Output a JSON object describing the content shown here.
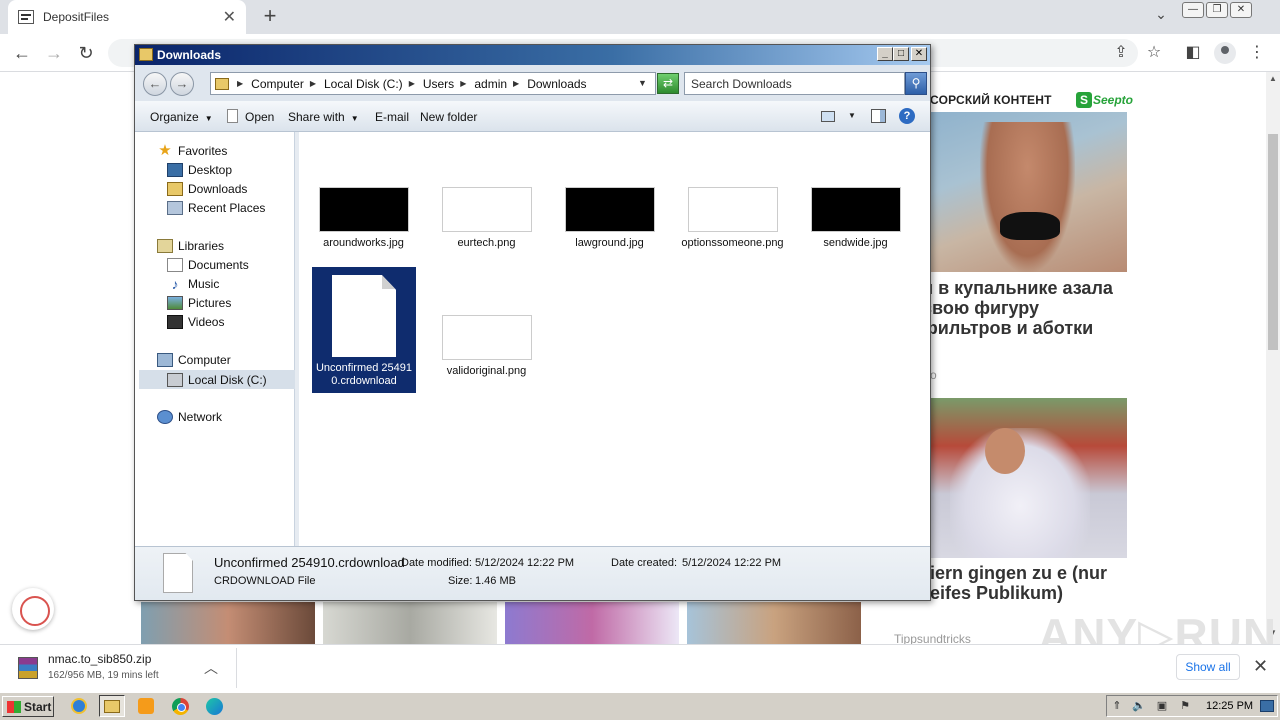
{
  "browser": {
    "tab_title": "DepositFiles",
    "tab_close": "✕",
    "new_tab": "+",
    "nav": {
      "back": "←",
      "forward": "→",
      "reload": "↻"
    }
  },
  "page_content": {
    "ad_header": "СОРСКИЙ КОНТЕНТ",
    "ad_logo": "Seepto",
    "ad_logo_letter": "S",
    "ad1_text": "и в купальнике азала свою фигуру фильтров и аботки",
    "ad1_source": "о",
    "ad2_text": "e Feiern gingen zu e (nur für reifes Publikum)",
    "ad2_source": "Tippsundtricks",
    "watermark": "ANY▷RUN"
  },
  "download_shelf": {
    "filename": "nmac.to_sib850.zip",
    "status": "162/956 MB, 19 mins left",
    "show_all": "Show all",
    "close": "✕"
  },
  "explorer": {
    "title": "Downloads",
    "title_buttons": {
      "min": "_",
      "max": "□",
      "close": "✕"
    },
    "address": {
      "crumbs": [
        "Computer",
        "Local Disk (C:)",
        "Users",
        "admin",
        "Downloads"
      ]
    },
    "search_placeholder": "Search Downloads",
    "commands": {
      "organize": "Organize",
      "open": "Open",
      "share_with": "Share with",
      "email": "E-mail",
      "new_folder": "New folder"
    },
    "nav": {
      "favorites": "Favorites",
      "desktop": "Desktop",
      "downloads": "Downloads",
      "recent_places": "Recent Places",
      "libraries": "Libraries",
      "documents": "Documents",
      "music": "Music",
      "pictures": "Pictures",
      "videos": "Videos",
      "computer": "Computer",
      "local_disk": "Local Disk (C:)",
      "network": "Network"
    },
    "files": [
      {
        "name": "aroundworks.jpg",
        "thumb": "dark"
      },
      {
        "name": "eurtech.png",
        "thumb": "light"
      },
      {
        "name": "lawground.jpg",
        "thumb": "dark"
      },
      {
        "name": "optionssomeone.png",
        "thumb": "light"
      },
      {
        "name": "sendwide.jpg",
        "thumb": "dark"
      },
      {
        "name": "Unconfirmed 254910.crdownload",
        "thumb": "doc",
        "selected": true
      },
      {
        "name": "validoriginal.png",
        "thumb": "light"
      }
    ],
    "details": {
      "name": "Unconfirmed 254910.crdownload",
      "type": "CRDOWNLOAD File",
      "date_modified_label": "Date modified:",
      "date_modified": "5/12/2024 12:22 PM",
      "size_label": "Size:",
      "size": "1.46 MB",
      "date_created_label": "Date created:",
      "date_created": "5/12/2024 12:22 PM"
    }
  },
  "taskbar": {
    "start": "Start",
    "clock": "12:25 PM"
  }
}
